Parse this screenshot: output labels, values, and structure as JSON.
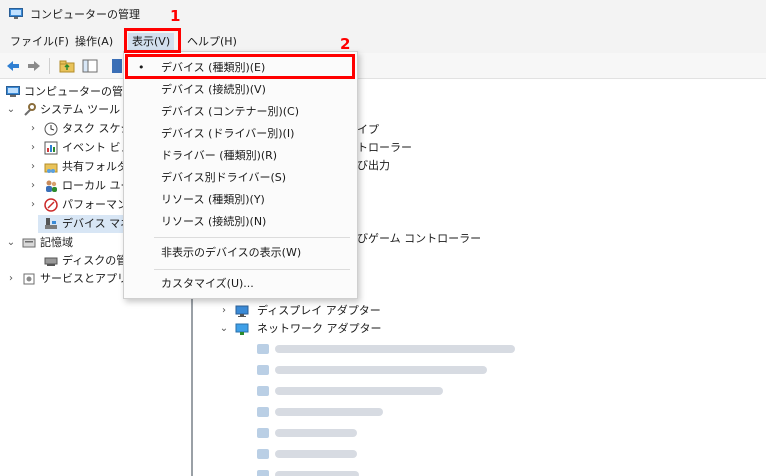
{
  "window": {
    "title": "コンピューターの管理"
  },
  "menubar": {
    "items": [
      "ファイル(F)",
      "操作(A)",
      "表示(V)",
      "ヘルプ(H)"
    ]
  },
  "left_tree": {
    "root": "コンピューターの管理",
    "system_tools": "システム ツール",
    "task_scheduler": "タスク スケジ",
    "event_viewer": "イベント ビュー",
    "shared_folders": "共有フォルダ",
    "local_users": "ローカル ユー",
    "performance": "パフォーマンス",
    "device_manager": "デバイス マネ",
    "storage": "記憶域",
    "disk_management": "ディスクの管理",
    "services_apps": "サービスとアプリケ"
  },
  "right_pane": {
    "frag_1": "イプ",
    "frag_2": "トローラー",
    "frag_3": "び出力",
    "frag_4": "びゲーム コントローラー",
    "display_adapters": "ディスプレイ アダプター",
    "network_adapters": "ネットワーク アダプター",
    "blurred_children": 7
  },
  "view_menu": {
    "items": [
      "デバイス (種類別)(E)",
      "デバイス (接続別)(V)",
      "デバイス (コンテナー別)(C)",
      "デバイス (ドライバー別)(I)",
      "ドライバー (種類別)(R)",
      "デバイス別ドライバー(S)",
      "リソース (種類別)(Y)",
      "リソース (接続別)(N)"
    ],
    "show_hidden": "非表示のデバイスの表示(W)",
    "customize": "カスタマイズ(U)...",
    "checked_bullet": "•"
  },
  "annotations": {
    "step1": "1",
    "step2": "2",
    "color": "#ff0000"
  }
}
